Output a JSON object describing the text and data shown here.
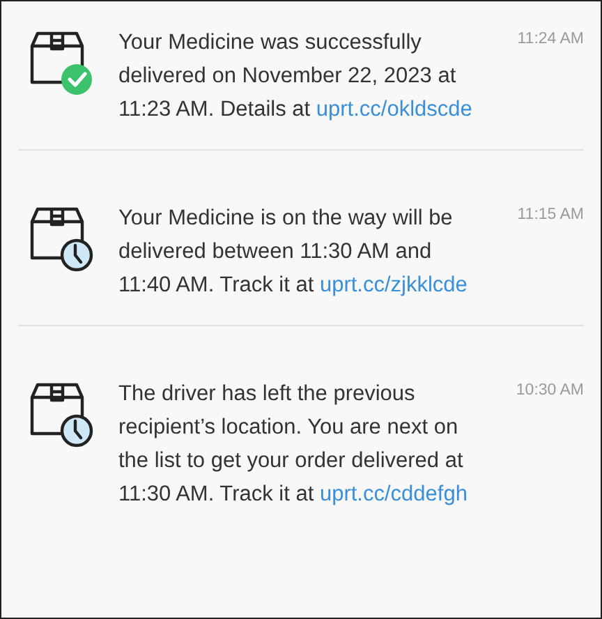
{
  "notifications": [
    {
      "kind": "delivered",
      "message": "Your Medicine was successfully delivered on November 22, 2023 at 11:23 AM. Details at",
      "link": "uprt.cc/okldscde",
      "time": "11:24 AM"
    },
    {
      "kind": "in_transit",
      "message": "Your Medicine is on the way will be delivered between 11:30 AM and 11:40 AM. Track it at",
      "link": "uprt.cc/zjkklcde",
      "time": "11:15 AM"
    },
    {
      "kind": "in_transit",
      "message": "The driver has left the previous recipient’s location. You are next on the list to get your order delivered at 11:30 AM. Track it at",
      "link": "uprt.cc/cddefgh",
      "time": "10:30 AM"
    }
  ]
}
